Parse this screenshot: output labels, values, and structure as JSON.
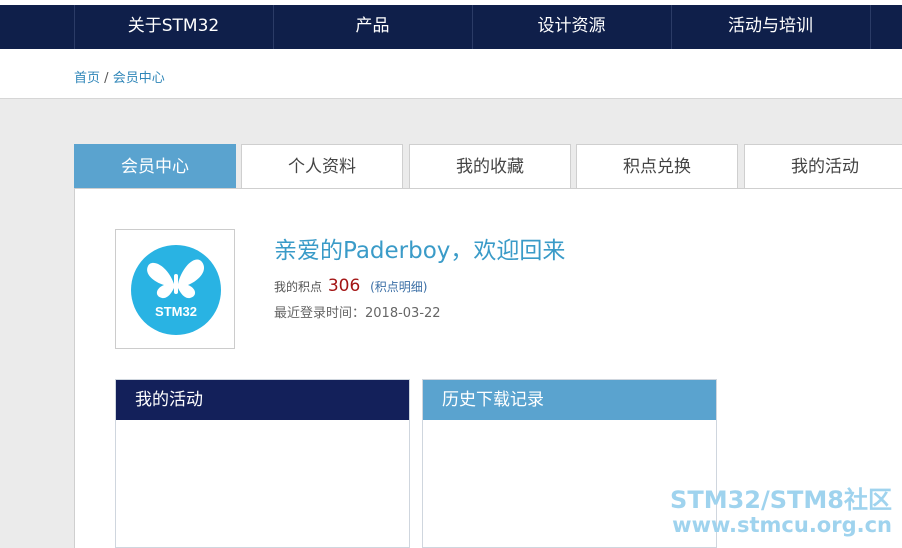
{
  "top_nav": {
    "items": [
      {
        "label": "关于STM32"
      },
      {
        "label": "产品"
      },
      {
        "label": "设计资源"
      },
      {
        "label": "活动与培训"
      }
    ]
  },
  "breadcrumb": {
    "home": "首页",
    "separator": "/",
    "current": "会员中心"
  },
  "tabs": [
    {
      "label": "会员中心",
      "active": true
    },
    {
      "label": "个人资料",
      "active": false
    },
    {
      "label": "我的收藏",
      "active": false
    },
    {
      "label": "积点兑换",
      "active": false
    },
    {
      "label": "我的活动",
      "active": false
    }
  ],
  "profile": {
    "avatar_icon": "stm32-butterfly-logo",
    "avatar_text": "STM32",
    "welcome": "亲爱的Paderboy，欢迎回来",
    "points_label": "我的积点",
    "points_value": "306",
    "points_detail_link": "(积点明细)",
    "last_login_label": "最近登录时间：",
    "last_login_value": "2018-03-22"
  },
  "boxes": {
    "activities_title": "我的活动",
    "downloads_title": "历史下载记录"
  },
  "watermark": {
    "line1": "STM32/STM8社区",
    "line2": "www.stmcu.org.cn"
  },
  "colors": {
    "nav_bg": "#0f1f4a",
    "tab_active": "#5aa3cf",
    "welcome_text": "#3a9bc8",
    "points_value": "#a31515",
    "logo_circle": "#29b3e3"
  }
}
